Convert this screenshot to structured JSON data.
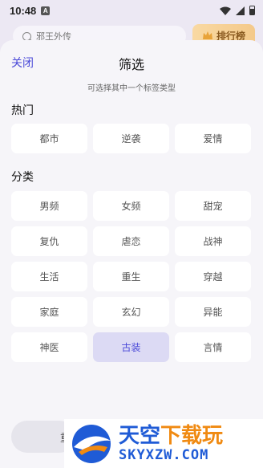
{
  "status_bar": {
    "time": "10:48",
    "notif_badge": "A"
  },
  "background": {
    "search_placeholder": "邪王外传",
    "rank_label": "排行榜"
  },
  "sheet": {
    "close_label": "关闭",
    "title": "筛选",
    "subtitle": "可选择其中一个标签类型",
    "hot_title": "热门",
    "hot_tags": [
      "都市",
      "逆袭",
      "爱情"
    ],
    "category_title": "分类",
    "category_tags": [
      "男频",
      "女频",
      "甜宠",
      "复仇",
      "虐恋",
      "战神",
      "生活",
      "重生",
      "穿越",
      "家庭",
      "玄幻",
      "异能",
      "神医",
      "古装",
      "言情"
    ],
    "selected_tag": "古装",
    "bottom_button_label": "重"
  },
  "watermark": {
    "brand_cn_blue": "天空",
    "brand_cn_orange": "下载玩",
    "brand_en": "SKYXZW.COM"
  },
  "colors": {
    "accent": "#4A49D8",
    "selected_bg": "#DCDAF4",
    "sheet_bg": "#F6F5F9"
  }
}
